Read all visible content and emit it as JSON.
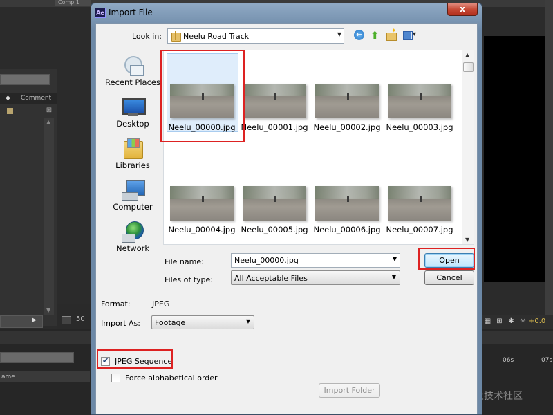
{
  "background": {
    "comp_tab": "Comp 1",
    "left_header": "Comment",
    "zoom": "50",
    "timeline_header": "ame",
    "ruler": [
      "06s",
      "07s"
    ],
    "right_value": "+0.0",
    "watermark": "@稀土掘金技术社区"
  },
  "dialog": {
    "app_icon": "Ae",
    "title": "Import File",
    "close_label": "x",
    "look_in_label": "Look in:",
    "look_in_value": "Neelu Road Track",
    "places": [
      {
        "label": "Recent Places",
        "icon": "recent-places-icon"
      },
      {
        "label": "Desktop",
        "icon": "desktop-icon"
      },
      {
        "label": "Libraries",
        "icon": "libraries-icon"
      },
      {
        "label": "Computer",
        "icon": "computer-icon"
      },
      {
        "label": "Network",
        "icon": "network-icon"
      }
    ],
    "files": [
      "Neelu_00000.jpg",
      "Neelu_00001.jpg",
      "Neelu_00002.jpg",
      "Neelu_00003.jpg",
      "Neelu_00004.jpg",
      "Neelu_00005.jpg",
      "Neelu_00006.jpg",
      "Neelu_00007.jpg"
    ],
    "selected_file": "Neelu_00000.jpg",
    "file_name_label": "File name:",
    "file_name_value": "Neelu_00000.jpg",
    "files_of_type_label": "Files of type:",
    "files_of_type_value": "All Acceptable Files",
    "open_label": "Open",
    "cancel_label": "Cancel",
    "format_label": "Format:",
    "format_value": "JPEG",
    "import_as_label": "Import As:",
    "import_as_value": "Footage",
    "jpeg_sequence_label": "JPEG Sequence",
    "jpeg_sequence_checked": true,
    "force_alpha_label": "Force alphabetical order",
    "force_alpha_checked": false,
    "import_folder_label": "Import Folder"
  }
}
